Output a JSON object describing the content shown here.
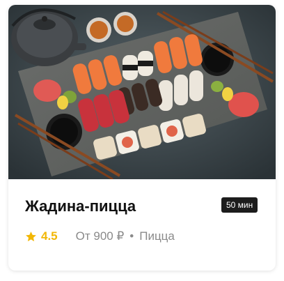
{
  "card": {
    "image_alt": "sushi-platter-photo",
    "title": "Жадина-пицца",
    "delivery_time": "50 мин",
    "rating": "4.5",
    "price": "От 900 ₽",
    "separator": "•",
    "category": "Пицца",
    "colors": {
      "rating": "#f2b705",
      "badge_bg": "#1c1c1c",
      "meta_text": "#8a8a8a"
    }
  }
}
